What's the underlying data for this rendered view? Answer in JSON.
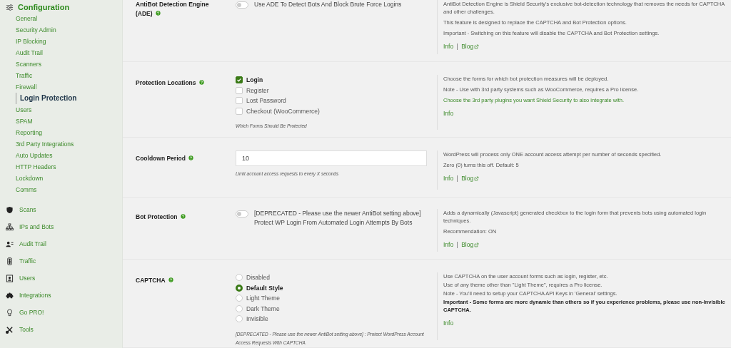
{
  "sidebar": {
    "heading": "Configuration",
    "subitems": [
      {
        "label": "General",
        "selected": false
      },
      {
        "label": "Security Admin",
        "selected": false
      },
      {
        "label": "IP Blocking",
        "selected": false
      },
      {
        "label": "Audit Trail",
        "selected": false
      },
      {
        "label": "Scanners",
        "selected": false
      },
      {
        "label": "Traffic",
        "selected": false
      },
      {
        "label": "Firewall",
        "selected": false
      },
      {
        "label": "Login Protection",
        "selected": true
      },
      {
        "label": "Users",
        "selected": false
      },
      {
        "label": "SPAM",
        "selected": false
      },
      {
        "label": "Reporting",
        "selected": false
      },
      {
        "label": "3rd Party Integrations",
        "selected": false
      },
      {
        "label": "Auto Updates",
        "selected": false
      },
      {
        "label": "HTTP Headers",
        "selected": false
      },
      {
        "label": "Lockdown",
        "selected": false
      },
      {
        "label": "Comms",
        "selected": false
      }
    ],
    "sections": [
      {
        "label": "Scans",
        "kind": "shield"
      },
      {
        "label": "IPs and Bots",
        "kind": "network"
      },
      {
        "label": "Audit Trail",
        "kind": "user-card"
      },
      {
        "label": "Traffic",
        "kind": "traffic"
      },
      {
        "label": "Users",
        "kind": "user"
      },
      {
        "label": "Integrations",
        "kind": "puzzle"
      },
      {
        "label": "Go PRO!",
        "kind": "bulb"
      },
      {
        "label": "Tools",
        "kind": "tools"
      }
    ]
  },
  "settings": [
    {
      "title": "AntiBot Detection Engine (ADE)",
      "control": {
        "kind": "toggle",
        "on": false,
        "label": "Use ADE To Detect Bots And Block Brute Force Logins"
      },
      "description": [
        {
          "kind": "text",
          "text": "AntiBot Detection Engine is Shield Security's exclusive bot-detection technology that removes the needs for CAPTCHA and other challenges."
        },
        {
          "kind": "text",
          "text": "This feature is designed to replace the CAPTCHA and Bot Protection options."
        },
        {
          "kind": "text",
          "text": "Important - Switching on this feature will disable the CAPTCHA and Bot Protection settings."
        }
      ],
      "links": [
        {
          "label": "Info",
          "external": false
        },
        {
          "label": "Blog",
          "external": true
        }
      ]
    },
    {
      "title": "Protection Locations",
      "control": {
        "kind": "checkboxes",
        "options": [
          {
            "label": "Login",
            "checked": true
          },
          {
            "label": "Register",
            "checked": false
          },
          {
            "label": "Lost Password",
            "checked": false
          },
          {
            "label": "Checkout (WooCommerce)",
            "checked": false
          }
        ],
        "help": "Which Forms Should Be Protected"
      },
      "description": [
        {
          "kind": "text",
          "text": "Choose the forms for which bot protection measures will be deployed."
        },
        {
          "kind": "text",
          "text": "Note - Use with 3rd party systems such as WooCommerce, requires a Pro license."
        },
        {
          "kind": "link",
          "text": "Choose the 3rd party plugins you want Shield Security to also integrate with."
        }
      ],
      "links": [
        {
          "label": "Info",
          "external": false
        }
      ]
    },
    {
      "title": "Cooldown Period",
      "control": {
        "kind": "number",
        "value": "10",
        "help": "Limit account access requests to every X seconds"
      },
      "description": [
        {
          "kind": "text",
          "text": "WordPress will process only ONE account access attempt per number of seconds specified."
        },
        {
          "kind": "tight",
          "text": "Zero (0) turns this off. Default: 5"
        }
      ],
      "links": [
        {
          "label": "Info",
          "external": false
        },
        {
          "label": "Blog",
          "external": true
        }
      ]
    },
    {
      "title": "Bot Protection",
      "control": {
        "kind": "toggle",
        "on": false,
        "label": "[DEPRECATED - Please use the newer AntiBot setting above] Protect WP Login From Automated Login Attempts By Bots"
      },
      "description": [
        {
          "kind": "text",
          "text": "Adds a dynamically (Javascript) generated checkbox to the login form that prevents bots using automated login techniques."
        },
        {
          "kind": "text",
          "text": "Recommendation: ON"
        }
      ],
      "links": [
        {
          "label": "Info",
          "external": false
        },
        {
          "label": "Blog",
          "external": true
        }
      ]
    },
    {
      "title": "CAPTCHA",
      "control": {
        "kind": "radios",
        "options": [
          {
            "label": "Disabled",
            "selected": false
          },
          {
            "label": "Default Style",
            "selected": true
          },
          {
            "label": "Light Theme",
            "selected": false
          },
          {
            "label": "Dark Theme",
            "selected": false
          },
          {
            "label": "Invisible",
            "selected": false
          }
        ],
        "help": "[DEPRECATED - Please use the newer AntiBot setting above] : Protect WordPress Account Access Requests With CAPTCHA"
      },
      "description": [
        {
          "kind": "tight",
          "text": "Use CAPTCHA on the user account forms such as login, register, etc."
        },
        {
          "kind": "tight",
          "text": "Use of any theme other than \"Light Theme\", requires a Pro license."
        },
        {
          "kind": "tight",
          "text": "Note - You'll need to setup your CAPTCHA API Keys in 'General' settings."
        },
        {
          "kind": "important",
          "text": "Important - Some forms are more dynamic than others so if you experience problems, please use non-Invisible CAPTCHA."
        }
      ],
      "links": [
        {
          "label": "Info",
          "external": false
        }
      ]
    }
  ]
}
